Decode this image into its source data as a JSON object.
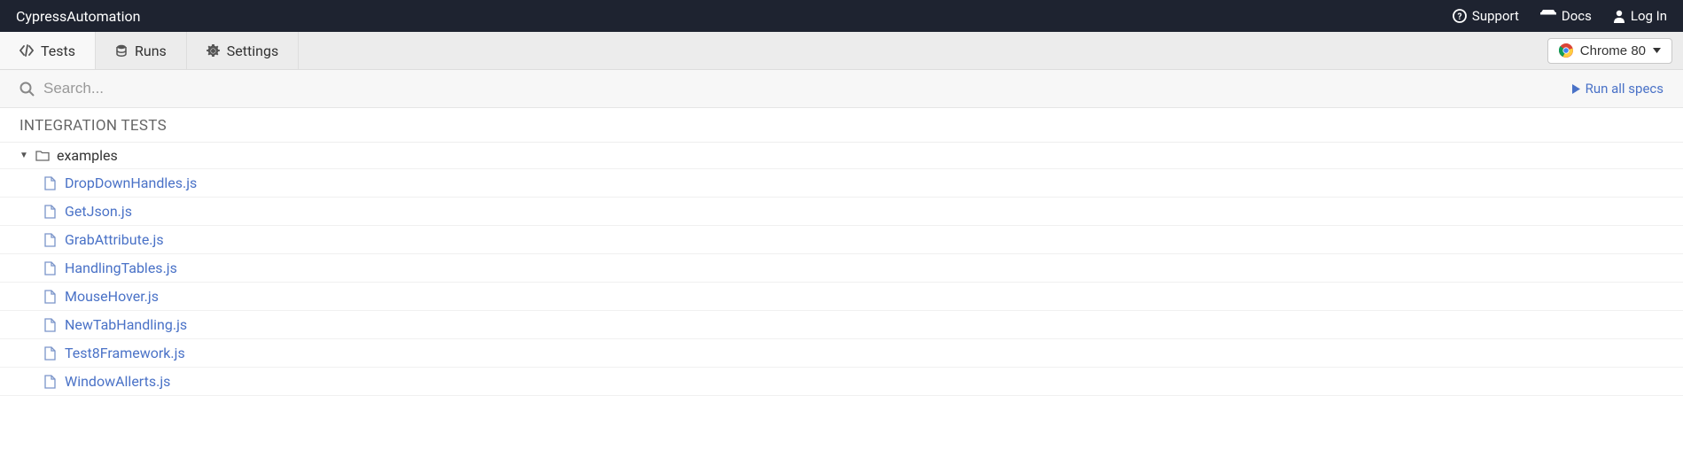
{
  "header": {
    "title": "CypressAutomation",
    "links": {
      "support": "Support",
      "docs": "Docs",
      "login": "Log In"
    }
  },
  "tabs": {
    "tests": "Tests",
    "runs": "Runs",
    "settings": "Settings"
  },
  "browser": {
    "label": "Chrome 80"
  },
  "search": {
    "placeholder": "Search...",
    "run_all": "Run all specs"
  },
  "section": {
    "title": "INTEGRATION TESTS"
  },
  "tree": {
    "folder": "examples",
    "files": [
      "DropDownHandles.js",
      "GetJson.js",
      "GrabAttribute.js",
      "HandlingTables.js",
      "MouseHover.js",
      "NewTabHandling.js",
      "Test8Framework.js",
      "WindowAllerts.js"
    ]
  }
}
